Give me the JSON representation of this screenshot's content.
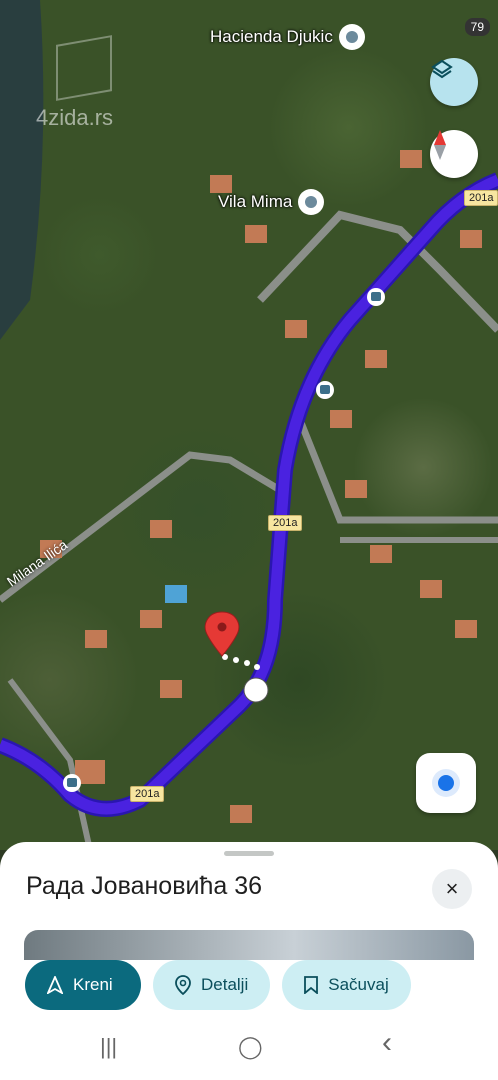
{
  "map": {
    "pois": [
      {
        "label": "Hacienda Djukic"
      },
      {
        "label": "Vila Mima"
      }
    ],
    "road_shields": [
      "201a",
      "201a",
      "201a"
    ],
    "street_label": "Milana Ilića",
    "watermark": "4zida.rs",
    "status_badge": "79"
  },
  "controls": {
    "layers": "layers-icon",
    "compass": "compass-icon",
    "my_location": "my-location-icon"
  },
  "sheet": {
    "title": "Рада Јовановића 36",
    "close": "×",
    "actions": [
      {
        "icon": "navigate-arrow-icon",
        "label": "Kreni"
      },
      {
        "icon": "location-pin-icon",
        "label": "Detalji"
      },
      {
        "icon": "bookmark-icon",
        "label": "Sačuvaj"
      }
    ]
  },
  "navbar": {
    "recent": "|||",
    "home": "◯",
    "back": "‹"
  },
  "colors": {
    "route": "#4a22e0",
    "accent": "#0b6a7e",
    "secondary_button": "#cdeef3",
    "marker": "#e53935"
  }
}
